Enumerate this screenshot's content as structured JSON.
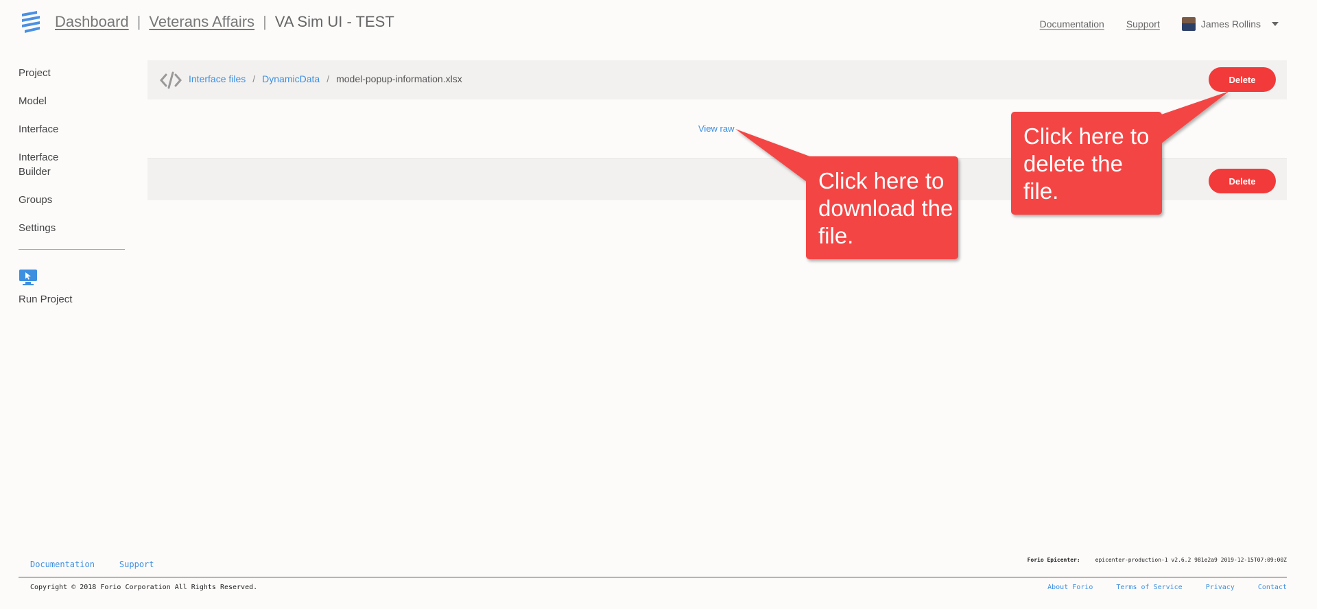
{
  "header": {
    "dashboard_link": "Dashboard",
    "separator": "|",
    "org_link": "Veterans Affairs",
    "project_name": "VA Sim UI - TEST",
    "nav": {
      "documentation": "Documentation",
      "support": "Support"
    },
    "user_name": "James Rollins"
  },
  "sidebar": {
    "items": [
      {
        "label": "Project"
      },
      {
        "label": "Model"
      },
      {
        "label": "Interface"
      },
      {
        "label": "Interface Builder"
      },
      {
        "label": "Groups"
      },
      {
        "label": "Settings"
      }
    ],
    "run_project": "Run Project"
  },
  "breadcrumb": {
    "root": "Interface files",
    "folder": "DynamicData",
    "file": "model-popup-information.xlsx",
    "separator": "/"
  },
  "actions": {
    "delete_label": "Delete",
    "view_raw": "View raw"
  },
  "callouts": {
    "download": "Click here to download the file.",
    "delete": "Click here to delete the file."
  },
  "footer": {
    "links_top": {
      "documentation": "Documentation",
      "support": "Support"
    },
    "version_label": "Forio Epicenter:",
    "version_value": "epicenter-production-1 v2.6.2 981e2a9 2019-12-15T07:09:00Z",
    "copyright": "Copyright © 2018 Forio Corporation All Rights Reserved.",
    "links_bottom": {
      "about": "About Forio",
      "terms": "Terms of Service",
      "privacy": "Privacy",
      "contact": "Contact"
    }
  },
  "colors": {
    "accent": "#3d8fe0",
    "danger": "#f33a3a",
    "callout": "#f44545"
  }
}
